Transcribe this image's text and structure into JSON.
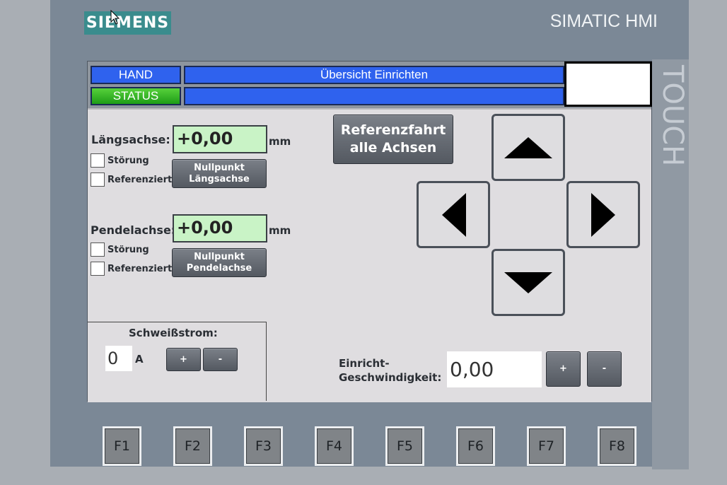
{
  "device": {
    "logo": "SIEMENS",
    "brand": "SIMATIC HMI",
    "side_label": "TOUCH"
  },
  "header": {
    "mode": "HAND",
    "title": "Übersicht Einrichten",
    "status": "STATUS",
    "status_text": ""
  },
  "laengsachse": {
    "label": "Längsachse:",
    "value": "+0,00",
    "unit": "mm",
    "stoerung_label": "Störung",
    "referenziert_label": "Referenziert",
    "zero_button_line1": "Nullpunkt",
    "zero_button_line2": "Längsachse"
  },
  "pendelachse": {
    "label": "Pendelachse:",
    "value": "+0,00",
    "unit": "mm",
    "stoerung_label": "Störung",
    "referenziert_label": "Referenziert",
    "zero_button_line1": "Nullpunkt",
    "zero_button_line2": "Pendelachse"
  },
  "referenzfahrt": {
    "line1": "Referenzfahrt",
    "line2": "alle Achsen"
  },
  "schweissstrom": {
    "label": "Schweißstrom:",
    "value": "0",
    "unit": "A",
    "plus": "+",
    "minus": "-"
  },
  "geschwindigkeit": {
    "label_line1": "Einricht-",
    "label_line2": "Geschwindigkeit:",
    "value": "0,00",
    "plus": "+",
    "minus": "-"
  },
  "function_keys": [
    "F1",
    "F2",
    "F3",
    "F4",
    "F5",
    "F6",
    "F7",
    "F8"
  ],
  "colors": {
    "header_blue": "#2f62ee",
    "status_green": "#2fb826",
    "io_field_green": "#c9f3c6",
    "bezel": "#7b8896"
  }
}
